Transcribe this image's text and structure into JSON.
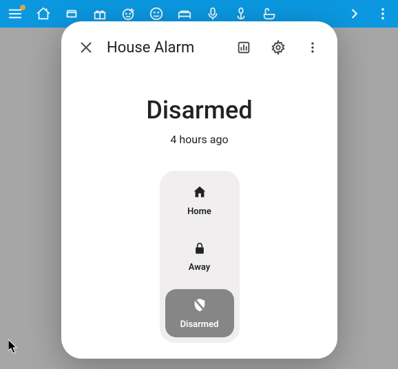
{
  "topbar": {
    "icons": [
      {
        "name": "menu-icon",
        "badge": true
      },
      {
        "name": "home-icon"
      },
      {
        "name": "sofa-icon"
      },
      {
        "name": "gift-icon"
      },
      {
        "name": "face-sparkle-icon"
      },
      {
        "name": "face-smile-icon"
      },
      {
        "name": "bed-icon"
      },
      {
        "name": "mic-icon"
      },
      {
        "name": "flower-icon"
      },
      {
        "name": "bathtub-icon"
      }
    ],
    "actions": [
      {
        "name": "chevron-right-icon"
      },
      {
        "name": "more-vert-icon"
      }
    ]
  },
  "dialog": {
    "title": "House Alarm",
    "header_icons": {
      "close": "close-icon",
      "stats": "chart-box-icon",
      "settings": "gear-icon",
      "more": "more-vert-icon"
    },
    "status": {
      "value": "Disarmed",
      "updated": "4 hours ago"
    },
    "options": [
      {
        "key": "home",
        "label": "Home",
        "icon": "house-icon",
        "selected": false
      },
      {
        "key": "away",
        "label": "Away",
        "icon": "lock-icon",
        "selected": false
      },
      {
        "key": "disarmed",
        "label": "Disarmed",
        "icon": "shield-off-icon",
        "selected": true
      }
    ]
  }
}
